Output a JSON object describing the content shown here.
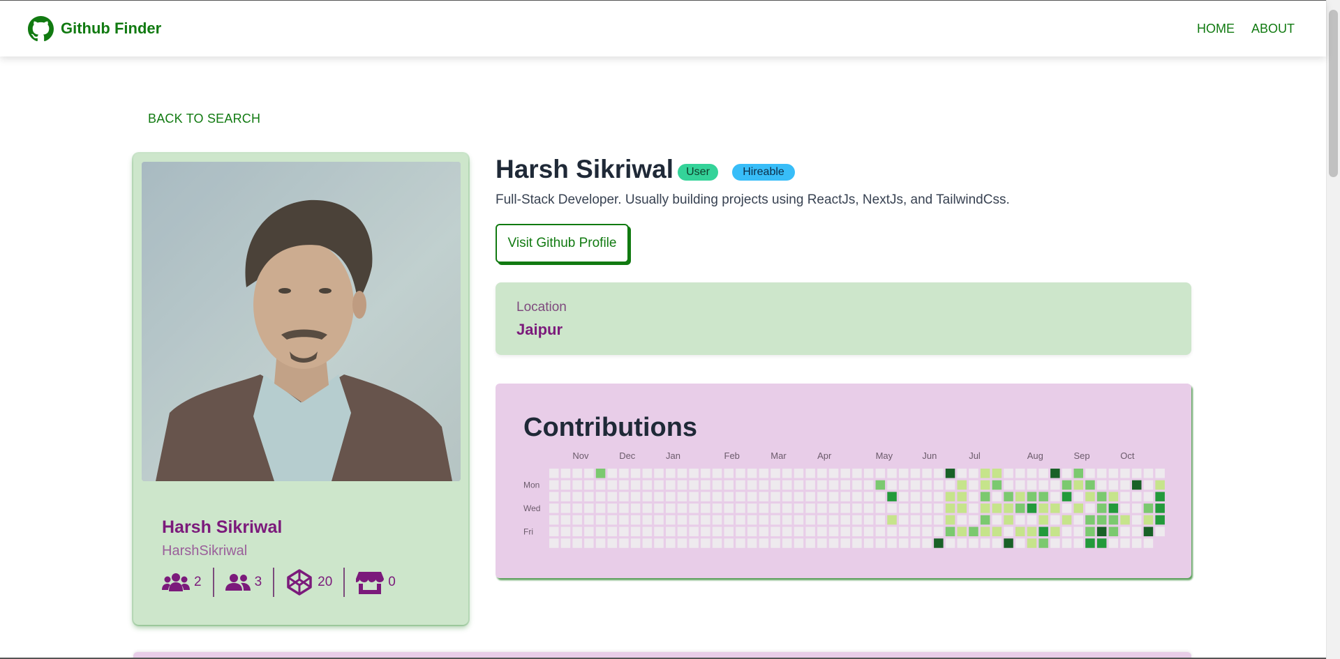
{
  "nav": {
    "brand": "Github Finder",
    "links": [
      "HOME",
      "ABOUT"
    ]
  },
  "back_label": "BACK TO SEARCH",
  "profile": {
    "name": "Harsh Sikriwal",
    "login": "HarshSikriwal",
    "stats": [
      {
        "icon": "followers-icon",
        "value": "2"
      },
      {
        "icon": "following-icon",
        "value": "3"
      },
      {
        "icon": "repos-icon",
        "value": "20"
      },
      {
        "icon": "gists-icon",
        "value": "0"
      }
    ]
  },
  "user": {
    "name": "Harsh Sikriwal",
    "badges": [
      "User",
      "Hireable"
    ],
    "bio": "Full-Stack Developer. Usually building projects using ReactJs, NextJs, and TailwindCss.",
    "visit_label": "Visit Github Profile"
  },
  "location": {
    "label": "Location",
    "value": "Jaipur"
  },
  "contributions": {
    "title": "Contributions",
    "months": [
      "Nov",
      "Dec",
      "Jan",
      "Feb",
      "Mar",
      "Apr",
      "May",
      "Jun",
      "Jul",
      "Aug",
      "Sep",
      "Oct"
    ],
    "days": [
      "Mon",
      "Wed",
      "Fri"
    ],
    "colors": [
      "#eeeaee",
      "#c6e48b",
      "#7bc96f",
      "#239a3b",
      "#196127"
    ]
  }
}
